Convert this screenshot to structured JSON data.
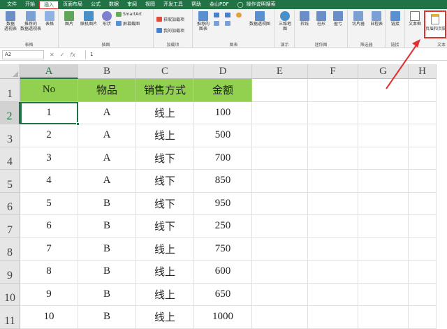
{
  "menu": {
    "tabs": [
      "文件",
      "开始",
      "插入",
      "页面布局",
      "公式",
      "数据",
      "审阅",
      "视图",
      "开发工具",
      "帮助",
      "金山PDF"
    ],
    "active_tab": "插入",
    "tell_me": "操作说明搜索"
  },
  "ribbon": {
    "groups": {
      "tables": "表格",
      "illustrations": "插图",
      "addins": "加载项",
      "charts": "图表",
      "tours": "演示",
      "sparklines": "迷你图",
      "filters": "筛选器",
      "links": "链接",
      "text": "文本"
    },
    "buttons": {
      "pivot_table": "数据\n透视表",
      "recommended_pivot": "推荐的\n数据透视表",
      "table": "表格",
      "pictures": "图片",
      "online_pictures": "联机图片",
      "shapes": "形状",
      "smartart": "SmartArt",
      "screenshot": "屏幕截图",
      "get_addins": "获取加载项",
      "my_addins": "我的加载项",
      "recommended_charts": "推荐的\n图表",
      "pivot_chart": "数据透视图",
      "map_3d": "三维地\n图",
      "line": "折线",
      "column": "柱形",
      "win_loss": "盈亏",
      "slicer": "切片器",
      "timeline": "日程表",
      "link": "链接",
      "textbox": "文本框",
      "header_footer": "页眉和页脚"
    }
  },
  "formula_bar": {
    "name_box": "A2",
    "cancel": "✕",
    "enter": "✓",
    "fx": "fx",
    "value": "1"
  },
  "columns": [
    "A",
    "B",
    "C",
    "D",
    "E",
    "F",
    "G",
    "H"
  ],
  "rows": [
    "1",
    "2",
    "3",
    "4",
    "5",
    "6",
    "7",
    "8",
    "9",
    "10",
    "11"
  ],
  "table": {
    "headers": [
      "No",
      "物品",
      "销售方式",
      "金额"
    ],
    "rows": [
      [
        "1",
        "A",
        "线上",
        "100"
      ],
      [
        "2",
        "A",
        "线上",
        "500"
      ],
      [
        "3",
        "A",
        "线下",
        "700"
      ],
      [
        "4",
        "A",
        "线下",
        "850"
      ],
      [
        "5",
        "B",
        "线下",
        "950"
      ],
      [
        "6",
        "B",
        "线下",
        "250"
      ],
      [
        "7",
        "B",
        "线上",
        "750"
      ],
      [
        "8",
        "B",
        "线上",
        "600"
      ],
      [
        "9",
        "B",
        "线上",
        "650"
      ],
      [
        "10",
        "B",
        "线上",
        "1000"
      ]
    ]
  },
  "colors": {
    "brand": "#217346",
    "header_fill": "#92d050",
    "annotation": "#e03030"
  }
}
